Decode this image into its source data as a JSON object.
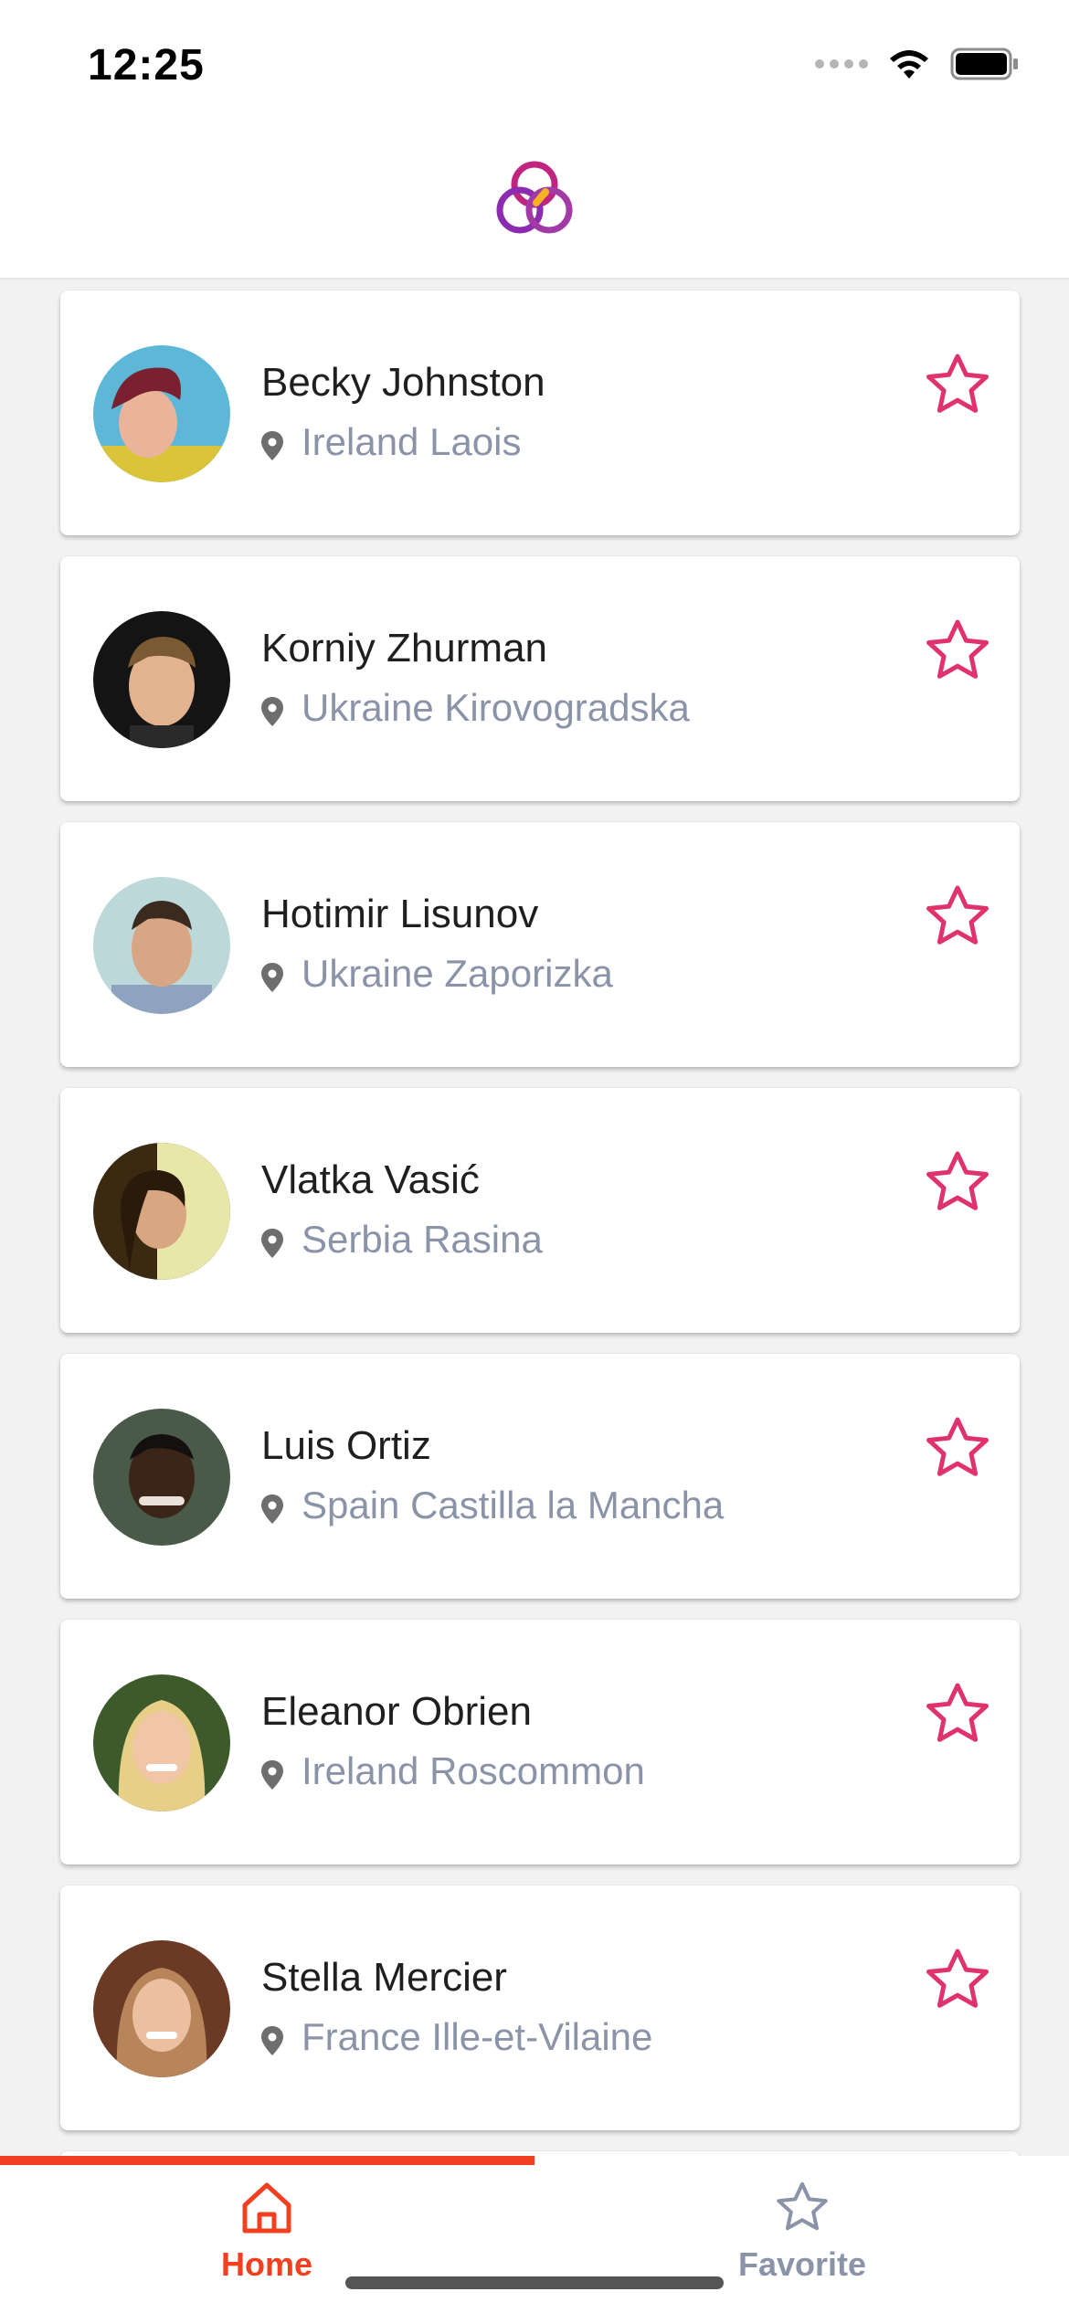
{
  "status_bar": {
    "time": "12:25"
  },
  "header": {
    "logo_icon": "three-rings-logo-icon",
    "logo_colors": [
      "#c0267f",
      "#8a2bb0",
      "#f5b323"
    ]
  },
  "people": [
    {
      "name": "Becky Johnston",
      "location": "Ireland Laois",
      "favorite": false
    },
    {
      "name": "Korniy Zhurman",
      "location": "Ukraine Kirovogradska",
      "favorite": false
    },
    {
      "name": "Hotimir Lisunov",
      "location": "Ukraine Zaporizka",
      "favorite": false
    },
    {
      "name": "Vlatka Vasić",
      "location": "Serbia Rasina",
      "favorite": false
    },
    {
      "name": "Luis Ortiz",
      "location": "Spain Castilla la Mancha",
      "favorite": false
    },
    {
      "name": "Eleanor Obrien",
      "location": "Ireland Roscommon",
      "favorite": false
    },
    {
      "name": "Stella Mercier",
      "location": "France Ille-et-Vilaine",
      "favorite": false
    }
  ],
  "tabs": {
    "home": {
      "label": "Home",
      "icon": "home-icon",
      "active": true
    },
    "favorite": {
      "label": "Favorite",
      "icon": "star-icon",
      "active": false
    }
  },
  "colors": {
    "accent": "#f0401f",
    "star": "#e0336b",
    "location_text": "#8a93a8",
    "inactive_tab": "#8a93a8"
  }
}
